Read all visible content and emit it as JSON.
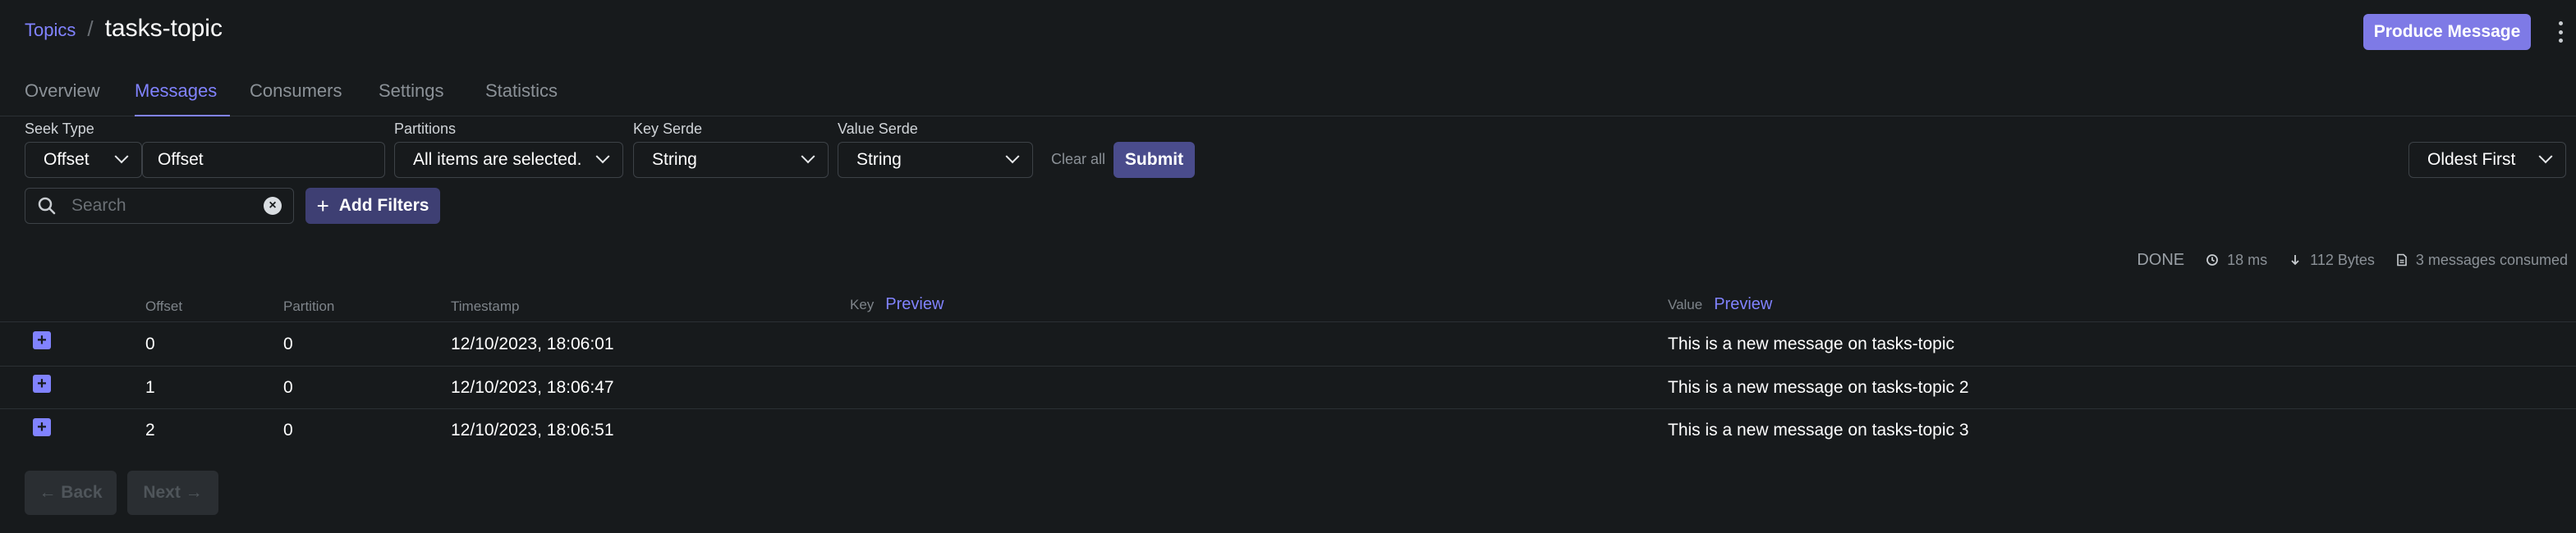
{
  "header": {
    "breadcrumb_link": "Topics",
    "breadcrumb_sep": "/",
    "title": "tasks-topic",
    "produce_button": "Produce Message"
  },
  "tabs": [
    {
      "label": "Overview"
    },
    {
      "label": "Messages",
      "active": true
    },
    {
      "label": "Consumers"
    },
    {
      "label": "Settings"
    },
    {
      "label": "Statistics"
    }
  ],
  "filters": {
    "seek_type_label": "Seek Type",
    "seek_type_value": "Offset",
    "seek_value": "Offset",
    "partitions_label": "Partitions",
    "partitions_value": "All items are selected.",
    "key_serde_label": "Key Serde",
    "key_serde_value": "String",
    "value_serde_label": "Value Serde",
    "value_serde_value": "String",
    "clear_all": "Clear all",
    "submit": "Submit",
    "sort": "Oldest First",
    "search_placeholder": "Search",
    "add_filters": "Add Filters"
  },
  "stats": {
    "status": "DONE",
    "time": "18 ms",
    "bytes": "112 Bytes",
    "messages": "3 messages consumed"
  },
  "table": {
    "headers": {
      "offset": "Offset",
      "partition": "Partition",
      "timestamp": "Timestamp",
      "key": "Key",
      "value": "Value",
      "preview": "Preview"
    },
    "rows": [
      {
        "offset": "0",
        "partition": "0",
        "timestamp": "12/10/2023, 18:06:01",
        "value": "This is a new message on tasks-topic"
      },
      {
        "offset": "1",
        "partition": "0",
        "timestamp": "12/10/2023, 18:06:47",
        "value": "This is a new message on tasks-topic 2"
      },
      {
        "offset": "2",
        "partition": "0",
        "timestamp": "12/10/2023, 18:06:51",
        "value": "This is a new message on tasks-topic 3"
      }
    ]
  },
  "pagination": {
    "back": "← Back",
    "next": "Next →"
  },
  "colors": {
    "accent": "#8183ff",
    "background": "#171a1c",
    "produce_button": "#7e7ae6"
  }
}
